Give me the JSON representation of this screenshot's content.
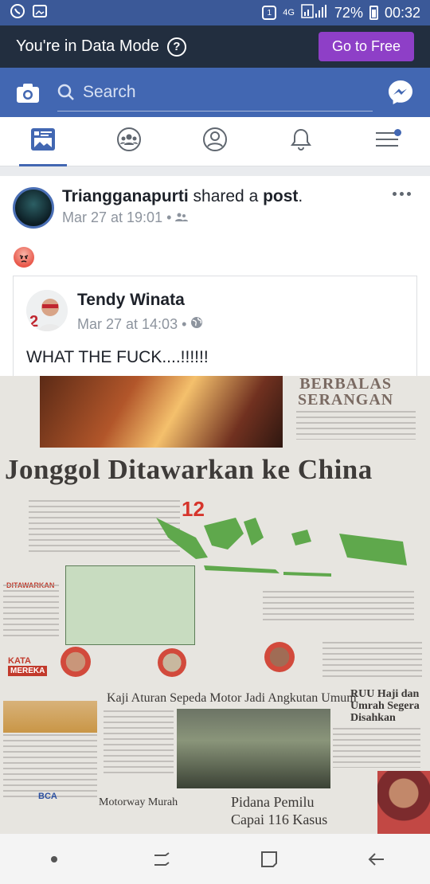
{
  "status_bar": {
    "notification_badge": "1",
    "network": "4G",
    "battery": "72%",
    "time": "00:32"
  },
  "data_mode_bar": {
    "message": "You're in Data Mode",
    "help": "?",
    "go_free_label": "Go to Free"
  },
  "search": {
    "placeholder": "Search"
  },
  "nav_tabs": [
    {
      "icon": "news-feed-icon",
      "active": true
    },
    {
      "icon": "groups-icon",
      "active": false
    },
    {
      "icon": "profile-icon",
      "active": false
    },
    {
      "icon": "notifications-icon",
      "active": false
    },
    {
      "icon": "menu-icon",
      "active": false,
      "badge_dot": true
    }
  ],
  "post": {
    "author": "Triangganapurti",
    "action": " shared a ",
    "object": "post",
    "punct": ".",
    "timestamp": "Mar 27 at 19:01 •",
    "privacy_icon": "friends-icon",
    "reaction_icon": "angry-emoji-icon",
    "shared": {
      "author": "Tendy Winata",
      "timestamp": "Mar 27 at 14:03 •",
      "privacy_icon": "globe-icon",
      "text": "WHAT THE FUCK....!!!!!!"
    },
    "newspaper": {
      "top_headline": [
        "BERBALAS",
        "SERANGAN"
      ],
      "headline": "Jonggol Ditawarkan ke China",
      "number": "12",
      "left_label": "DITAWARKAN",
      "kata": "KATA",
      "mereka": "MEREKA",
      "story1": "Kaji Aturan Sepeda Motor Jadi Angkutan Umum",
      "story2_lines": [
        "RUU Haji dan",
        "Umrah Segera",
        "Disahkan"
      ],
      "story3": "Motorway Murah",
      "story4_lines": [
        "Pidana Pemilu",
        "Capai 116 Kasus"
      ],
      "ad": "BCA"
    }
  },
  "colors": {
    "brand_blue": "#4267b2",
    "status_blue": "#3b5998",
    "data_bar": "#222e3f",
    "go_free": "#8e3fc7"
  }
}
